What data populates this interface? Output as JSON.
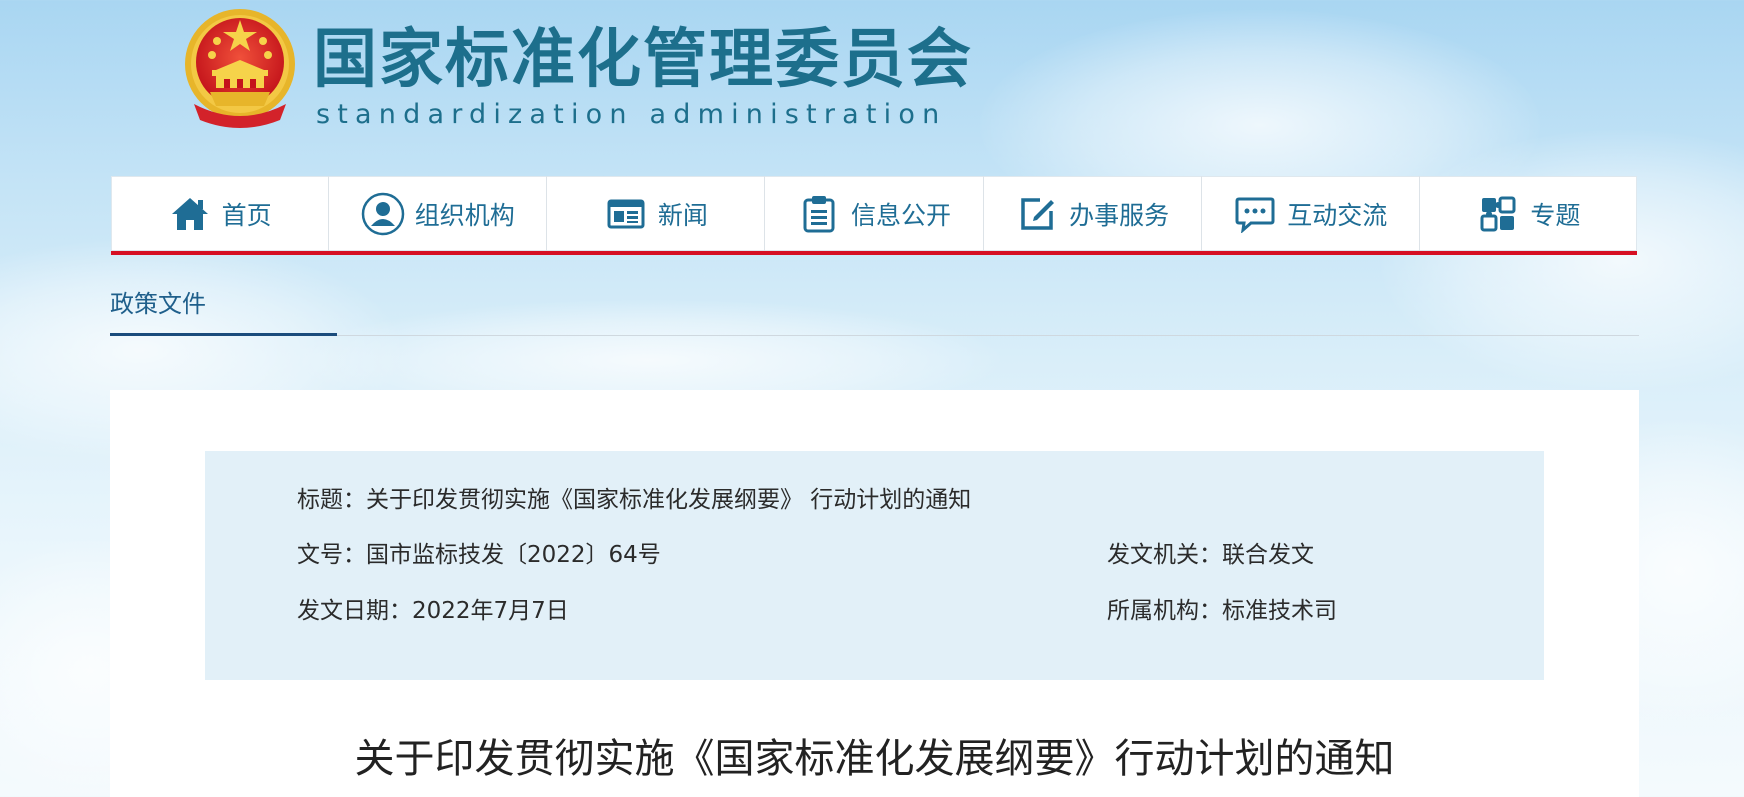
{
  "header": {
    "title": "国家标准化管理委员会",
    "subtitle": "standardization administration",
    "emblem_icon": "national-emblem-icon"
  },
  "nav": {
    "items": [
      {
        "label": "首页",
        "icon": "home-icon"
      },
      {
        "label": "组织机构",
        "icon": "user-circle-icon"
      },
      {
        "label": "新闻",
        "icon": "newspaper-icon"
      },
      {
        "label": "信息公开",
        "icon": "clipboard-icon"
      },
      {
        "label": "办事服务",
        "icon": "edit-icon"
      },
      {
        "label": "互动交流",
        "icon": "chat-bubble-icon"
      },
      {
        "label": "专题",
        "icon": "puzzle-icon"
      }
    ],
    "accent_color": "#d60f23",
    "text_color": "#1f6d95"
  },
  "section": {
    "tab_label": "政策文件"
  },
  "meta": {
    "title_label": "标题：",
    "title_value": "关于印发贯彻实施《国家标准化发展纲要》 行动计划的通知",
    "doc_no_label": "文号：",
    "doc_no_value": "国市监标技发〔2022〕64号",
    "issuer_label": "发文机关：",
    "issuer_value": "联合发文",
    "date_label": "发文日期：",
    "date_value": "2022年7月7日",
    "org_label": "所属机构：",
    "org_value": "标准技术司"
  },
  "document": {
    "title": "关于印发贯彻实施《国家标准化发展纲要》行动计划的通知"
  }
}
